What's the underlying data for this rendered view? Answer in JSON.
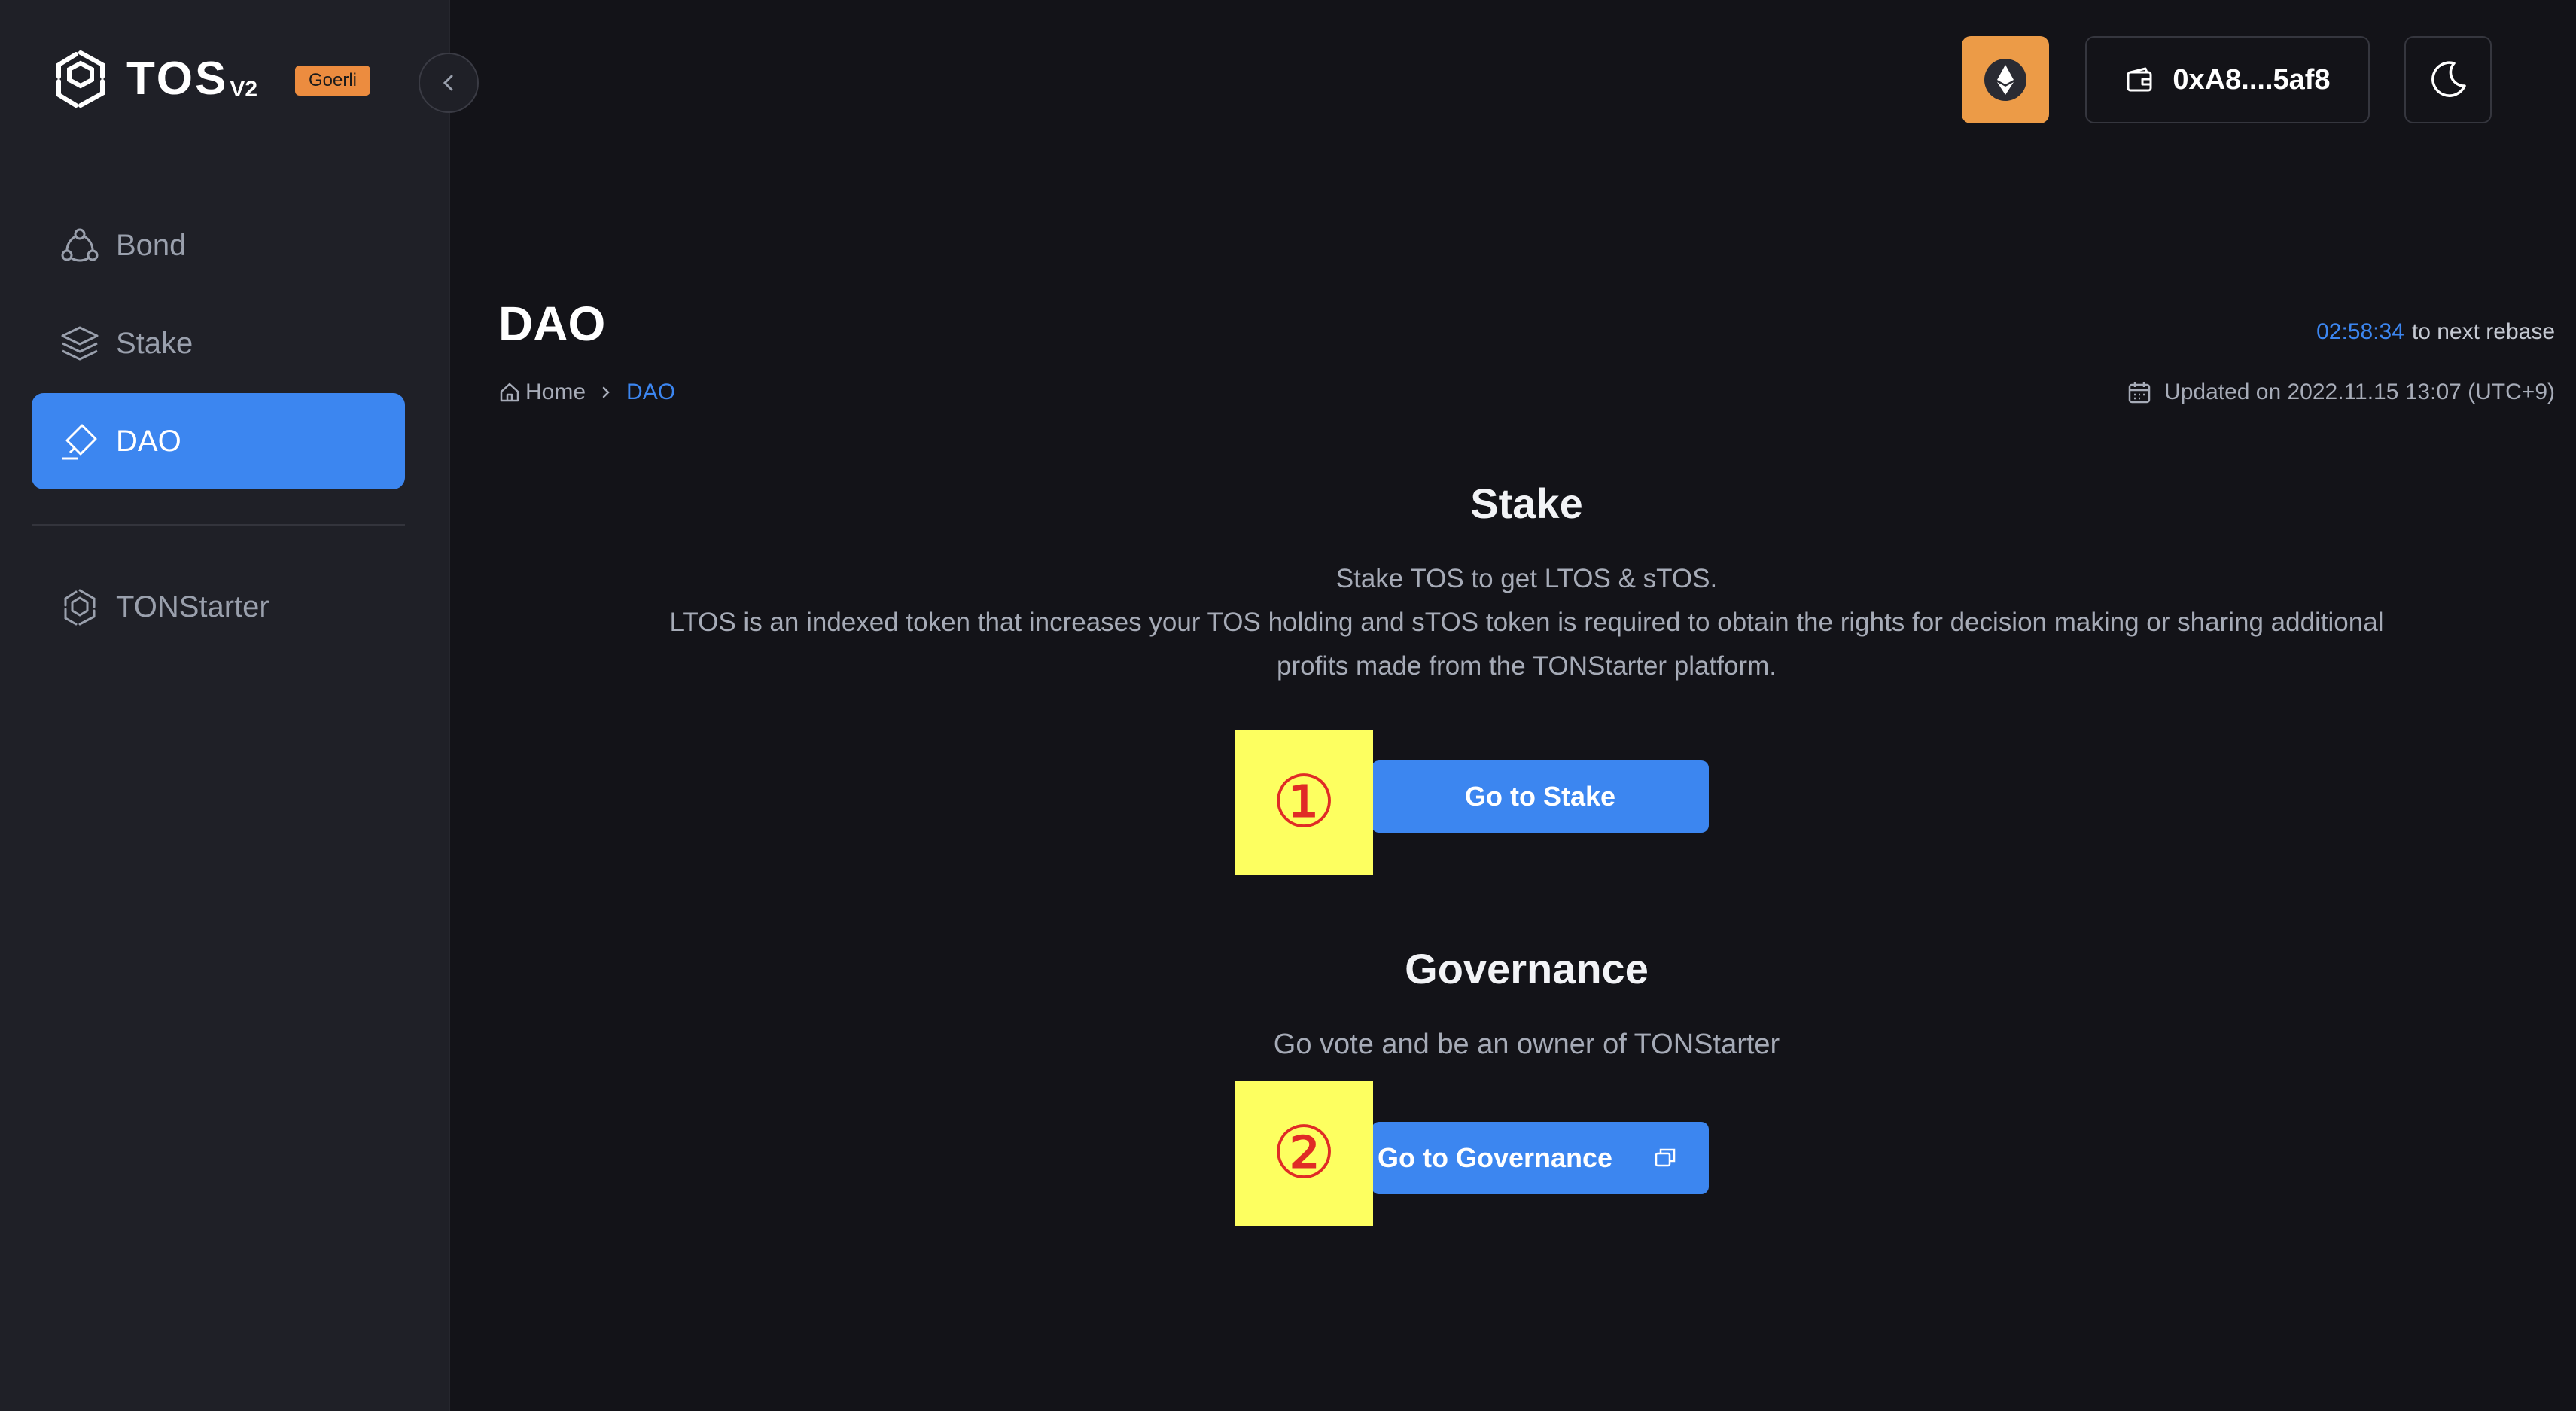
{
  "app": {
    "logo_text": "TOS",
    "logo_version": "V2",
    "network": "Goerli"
  },
  "sidebar": {
    "items": [
      {
        "label": "Bond",
        "icon": "bond-icon",
        "active": false
      },
      {
        "label": "Stake",
        "icon": "layers-icon",
        "active": false
      },
      {
        "label": "DAO",
        "icon": "dao-icon",
        "active": true
      },
      {
        "label": "TONStarter",
        "icon": "tonstarter-icon",
        "active": false
      }
    ]
  },
  "header": {
    "network_icon": "ethereum-icon",
    "wallet_address": "0xA8....5af8",
    "wallet_icon": "wallet-icon",
    "theme_icon": "moon-icon"
  },
  "page": {
    "title": "DAO",
    "breadcrumb": {
      "home": "Home",
      "current": "DAO"
    },
    "rebase_time": "02:58:34",
    "rebase_text": "to next rebase",
    "updated": "Updated on 2022.11.15 13:07 (UTC+9)"
  },
  "stake_section": {
    "title": "Stake",
    "line1": "Stake TOS to get LTOS & sTOS.",
    "line2": "LTOS is an indexed token that increases your TOS holding and sTOS token is required to obtain the rights for decision making or sharing additional profits made from the TONStarter platform.",
    "button": "Go to Stake",
    "marker": "①"
  },
  "governance_section": {
    "title": "Governance",
    "description": "Go vote and be an owner of TONStarter",
    "button": "Go to Governance",
    "marker": "②"
  },
  "colors": {
    "accent": "#3c86f0",
    "badge": "#ec8c3f",
    "eth_button": "#ec9b47",
    "sidebar_bg": "#1f2027",
    "main_bg": "#131318",
    "marker_bg": "#fdff60",
    "marker_text": "#e02b26"
  }
}
